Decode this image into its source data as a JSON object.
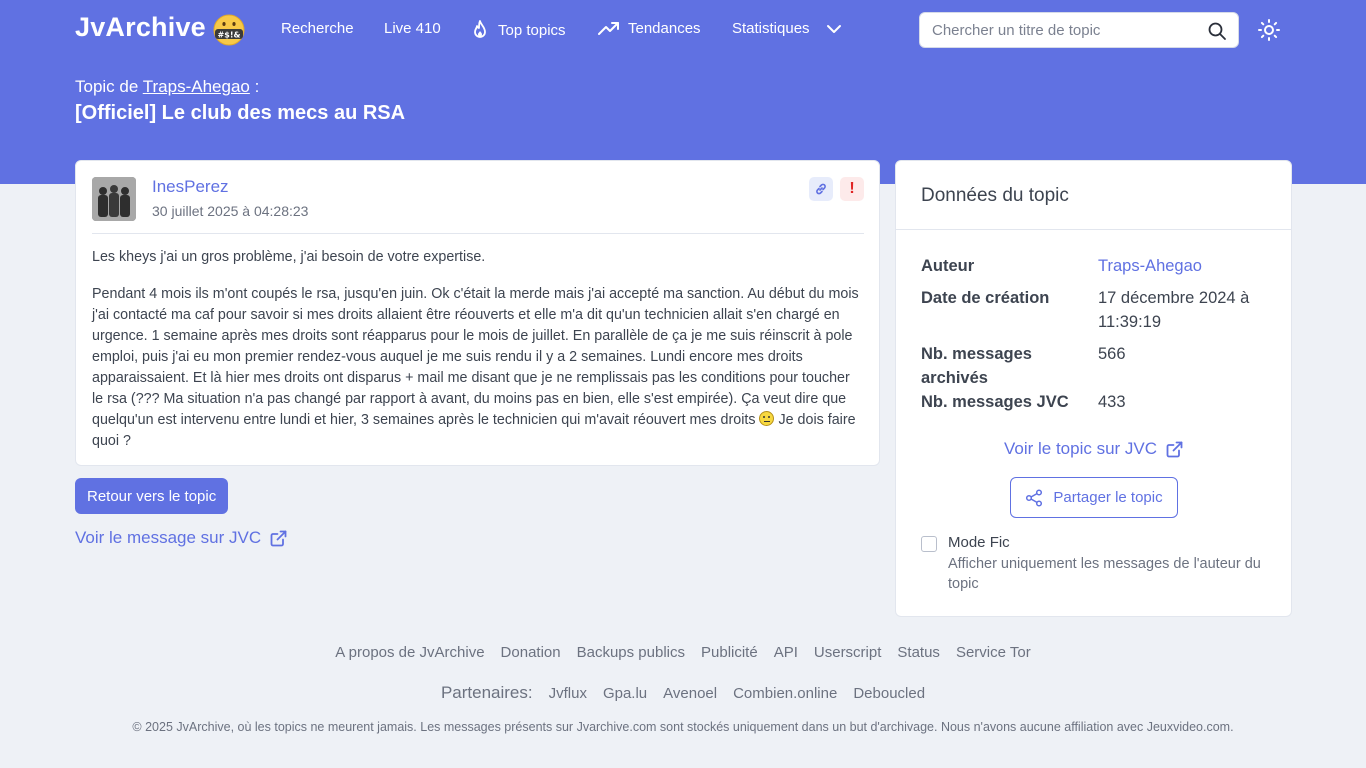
{
  "nav": {
    "logo": "JvArchive",
    "logo_emoji": "#$!&",
    "items": [
      {
        "label": "Recherche",
        "icon": "none"
      },
      {
        "label": "Live 410",
        "icon": "none"
      },
      {
        "label": "Top topics",
        "icon": "flame-icon"
      },
      {
        "label": "Tendances",
        "icon": "trending-up-icon"
      },
      {
        "label": "Statistiques",
        "icon": "chevron-down-icon"
      }
    ],
    "search_placeholder": "Chercher un titre de topic",
    "search_value": ""
  },
  "topic": {
    "by_prefix": "Topic de",
    "author": "Traps-Ahegao",
    "by_suffix": ":",
    "title": "[Officiel] Le club des mecs au RSA"
  },
  "message": {
    "author": "InesPerez",
    "date": "30 juillet 2025 à 04:28:23",
    "paragraph_1": "Les kheys j'ai un gros problème, j'ai besoin de votre expertise.",
    "paragraph_2": "Pendant 4 mois ils m'ont coupés le rsa, jusqu'en juin. Ok c'était la merde mais j'ai accepté ma sanction. Au début du mois j'ai contacté ma caf pour savoir si mes droits allaient être réouverts et elle m'a dit qu'un technicien allait s'en chargé en urgence. 1 semaine après mes droits sont réapparus pour le mois de juillet. En parallèle de ça je me suis réinscrit à pole emploi, puis j'ai eu mon premier rendez-vous auquel je me suis rendu il y a 2 semaines. Lundi encore mes droits apparaissaient. Et là hier mes droits ont disparus + mail me disant que je ne remplissais pas les conditions pour toucher le rsa (??? Ma situation n'a pas changé par rapport à avant, du moins pas en bien, elle s'est empirée). Ça veut dire que quelqu'un est intervenu entre lundi et hier, 3 semaines après le technicien qui m'avait réouvert mes droits",
    "paragraph_2_end": "Je dois faire quoi ?",
    "report_symbol": "!"
  },
  "actions": {
    "back_label": "Retour vers le topic",
    "jvc_message_label": "Voir le message sur JVC"
  },
  "sidebar": {
    "title": "Données du topic",
    "rows": [
      {
        "label": "Auteur",
        "value": "Traps-Ahegao"
      },
      {
        "label": "Date de création",
        "value": "17 décembre 2024 à 11:39:19"
      },
      {
        "label": "Nb. messages archivés",
        "value": "566"
      },
      {
        "label": "Nb. messages JVC",
        "value": "433"
      }
    ],
    "jvc_topic_label": "Voir le topic sur JVC",
    "share_label": "Partager le topic",
    "fic_title": "Mode Fic",
    "fic_desc": "Afficher uniquement les messages de l'auteur du topic",
    "fic_checked": false
  },
  "footer": {
    "links": [
      "A propos de JvArchive",
      "Donation",
      "Backups publics",
      "Publicité",
      "API",
      "Userscript",
      "Status",
      "Service Tor"
    ],
    "partners_label": "Partenaires:",
    "partners": [
      "Jvflux",
      "Gpa.lu",
      "Avenoel",
      "Combien.online",
      "Deboucled"
    ],
    "copyright": "© 2025 JvArchive, où les topics ne meurent jamais. Les messages présents sur Jvarchive.com sont stockés uniquement dans un but d'archivage. Nous n'avons aucune affiliation avec Jeuxvideo.com."
  },
  "colors": {
    "accent": "#6071e2",
    "background": "#eef1f6",
    "card": "#ffffff",
    "report": "#e02424"
  }
}
